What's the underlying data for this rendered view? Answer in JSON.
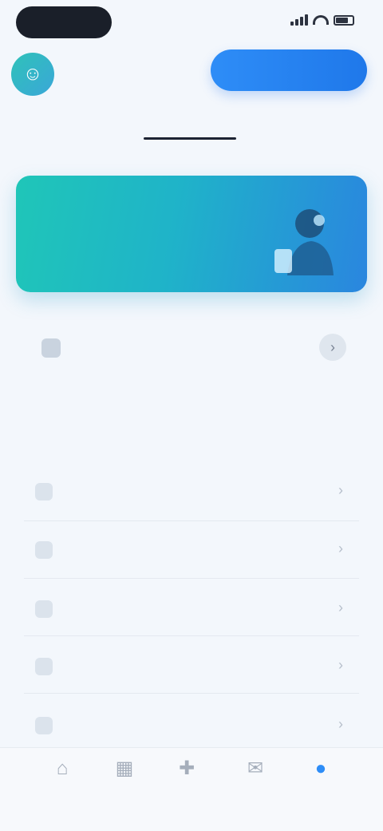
{
  "status": {
    "time": "",
    "signal_icon": "signal-icon",
    "wifi_icon": "wifi-icon",
    "battery_icon": "battery-icon"
  },
  "header": {
    "avatar_icon": "user-avatar-icon",
    "user_name": "",
    "user_subtitle": "",
    "primary_button_label": ""
  },
  "tabs": [
    {
      "label": "",
      "active": false
    },
    {
      "label": "",
      "active": true
    }
  ],
  "banner": {
    "title": "",
    "subtitle": "",
    "art_icon": "illustration-icon",
    "colors": {
      "start": "#1fc6b8",
      "end": "#2a86df"
    }
  },
  "info_row": {
    "icon": "info-icon",
    "text": "",
    "chevron_icon": "chevron-right-icon"
  },
  "section": {
    "title": "",
    "items": [
      {
        "label": "",
        "icon": "list-icon",
        "chevron": "›"
      },
      {
        "label": "",
        "icon": "list-icon",
        "chevron": "›"
      },
      {
        "label": "",
        "icon": "list-icon",
        "chevron": "›"
      },
      {
        "label": "",
        "icon": "list-icon",
        "chevron": "›"
      },
      {
        "label": "",
        "icon": "list-icon",
        "chevron": "›"
      }
    ]
  },
  "bottom_nav": [
    {
      "label": "",
      "icon": "home-icon",
      "glyph": "⌂",
      "active": false
    },
    {
      "label": "",
      "icon": "grid-icon",
      "glyph": "▦",
      "active": false
    },
    {
      "label": "",
      "icon": "plus-icon",
      "glyph": "✚",
      "active": false
    },
    {
      "label": "",
      "icon": "message-icon",
      "glyph": "✉",
      "active": false
    },
    {
      "label": "",
      "icon": "profile-icon",
      "glyph": "●",
      "active": true
    }
  ],
  "colors": {
    "accent": "#2e8df7",
    "background": "#f3f7fc",
    "text": "#1c2333"
  }
}
